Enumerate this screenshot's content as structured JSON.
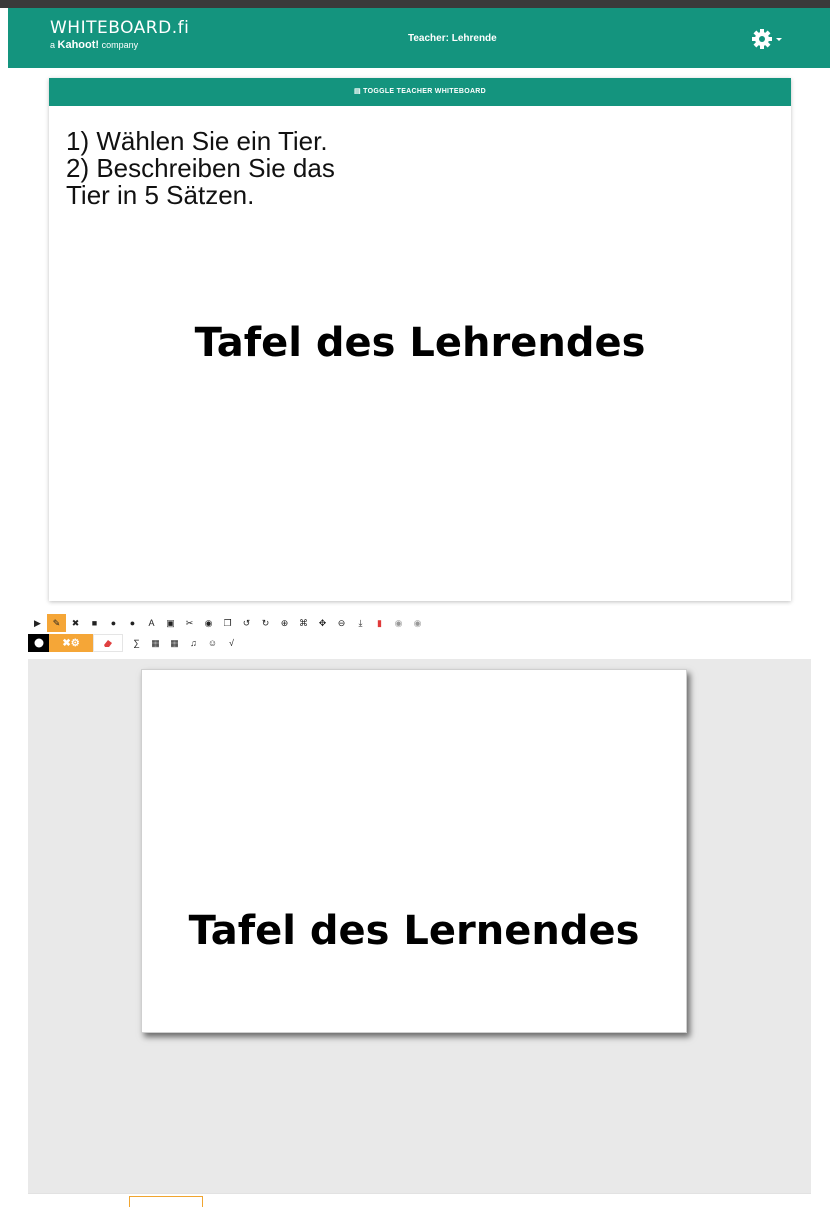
{
  "header": {
    "logo_title": "WHITEBOARD.fi",
    "logo_prefix": "a",
    "logo_brand": "Kahoot!",
    "logo_suffix": "company",
    "teacher_label": "Teacher: Lehrende",
    "settings_icon": "gear-icon"
  },
  "teacher_panel": {
    "toggle_label": "TOGGLE TEACHER WHITEBOARD",
    "task_lines": [
      "1) Wählen Sie ein Tier.",
      "2) Beschreiben Sie das",
      "Tier in 5 Sätzen."
    ],
    "board_label": "Tafel des Lehrendes"
  },
  "toolbar": {
    "row1": [
      "pointer",
      "pen",
      "cross",
      "square",
      "circle-filled",
      "circle",
      "text",
      "image",
      "cut",
      "bucket",
      "copy",
      "undo",
      "redo",
      "zoom-in",
      "fit",
      "move",
      "zoom-out",
      "download",
      "delete",
      "hide",
      "show"
    ],
    "row1_text_tool": "A",
    "row2_tools": [
      "formula-sigma",
      "grid",
      "grid-alt",
      "music-note",
      "smiley",
      "sqrt"
    ],
    "active_tool": "pen",
    "accent_color": "#f5a637"
  },
  "student_panel": {
    "board_label": "Tafel des Lernendes"
  },
  "colors": {
    "brand": "#14947e",
    "workspace": "#e9e9e9",
    "accent": "#f5a637"
  }
}
